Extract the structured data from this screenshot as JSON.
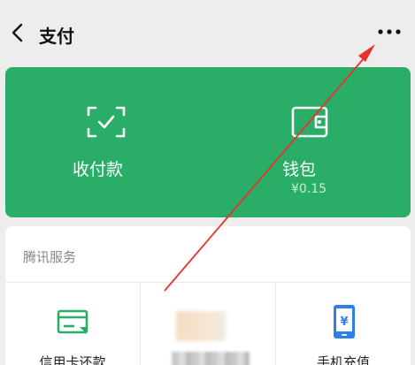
{
  "header": {
    "title": "支付",
    "back_icon": "chevron-left-icon",
    "more_icon": "more-dots-icon"
  },
  "wallet_card": {
    "accent_color": "#2aae67",
    "collect_pay": {
      "label": "收付款",
      "icon": "scan-qr-icon"
    },
    "wallet": {
      "label": "钱包",
      "balance": "¥0.15",
      "icon": "wallet-icon"
    }
  },
  "services": {
    "title": "腾讯服务",
    "items": [
      {
        "label": "信用卡还款",
        "icon": "credit-card-icon"
      },
      {
        "label": "",
        "icon": "blurred-icon"
      },
      {
        "label": "手机充值",
        "icon": "mobile-topup-icon"
      }
    ]
  },
  "annotation": {
    "color": "#e8322a"
  }
}
